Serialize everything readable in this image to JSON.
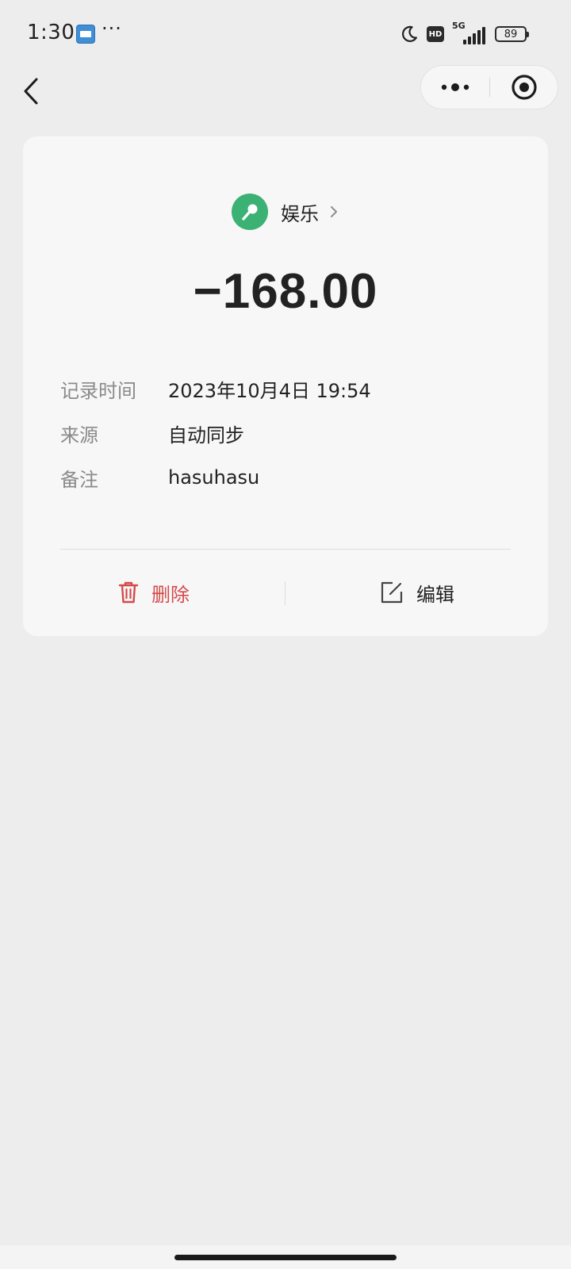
{
  "status_bar": {
    "time": "1:30",
    "more": "···",
    "network": "5G",
    "hd": "HD",
    "battery": "89"
  },
  "icons": {
    "back": "chevron-left-icon",
    "menu": "more-dots-icon",
    "close": "target-close-icon",
    "category": "microphone-icon",
    "delete": "trash-icon",
    "edit": "edit-icon"
  },
  "colors": {
    "category_bg": "#3bb174",
    "delete": "#d44a4a",
    "background": "#ededed",
    "card": "#f7f7f7"
  },
  "record": {
    "category": "娱乐",
    "amount": "−168.00",
    "details": [
      {
        "label": "记录时间",
        "value": "2023年10月4日 19:54"
      },
      {
        "label": "来源",
        "value": "自动同步"
      },
      {
        "label": "备注",
        "value": "hasuhasu"
      }
    ]
  },
  "actions": {
    "delete_label": "删除",
    "edit_label": "编辑"
  }
}
